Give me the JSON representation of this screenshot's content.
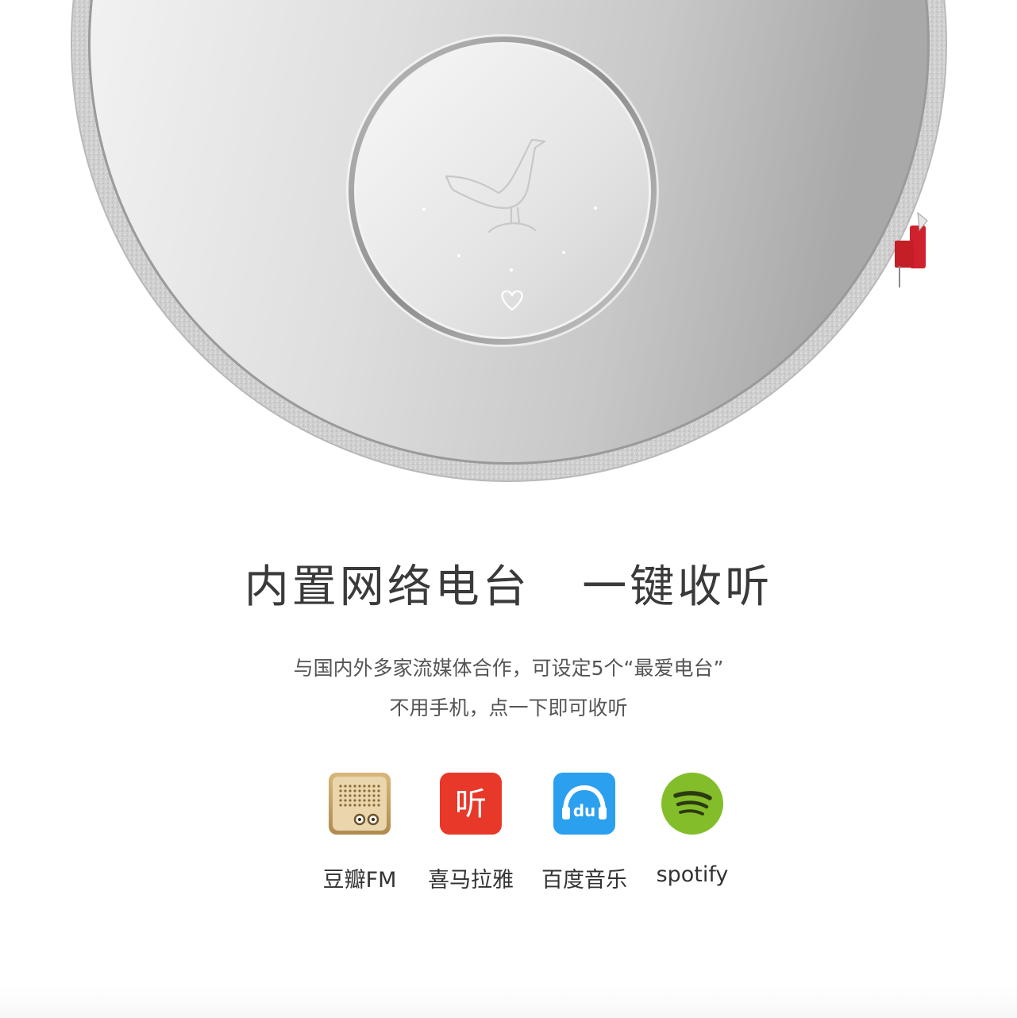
{
  "headline": "内置网络电台   一键收听",
  "description": {
    "line1": "与国内外多家流媒体合作，可设定5个“最爱电台”",
    "line2": "不用手机，点一下即可收听"
  },
  "services": [
    {
      "label": "豆瓣FM",
      "icon": "douban-fm-icon"
    },
    {
      "label": "喜马拉雅",
      "icon": "ximalaya-icon"
    },
    {
      "label": "百度音乐",
      "icon": "baidu-music-icon"
    },
    {
      "label": "spotify",
      "icon": "spotify-icon"
    }
  ],
  "colors": {
    "ximalaya": "#e8382a",
    "baidu": "#2aa0ee",
    "spotify": "#84bd2a",
    "douban": "#c8a467",
    "accent_tag": "#d0222c"
  },
  "logos": {
    "ximalaya_glyph": "听",
    "baidu_glyph": "du"
  }
}
